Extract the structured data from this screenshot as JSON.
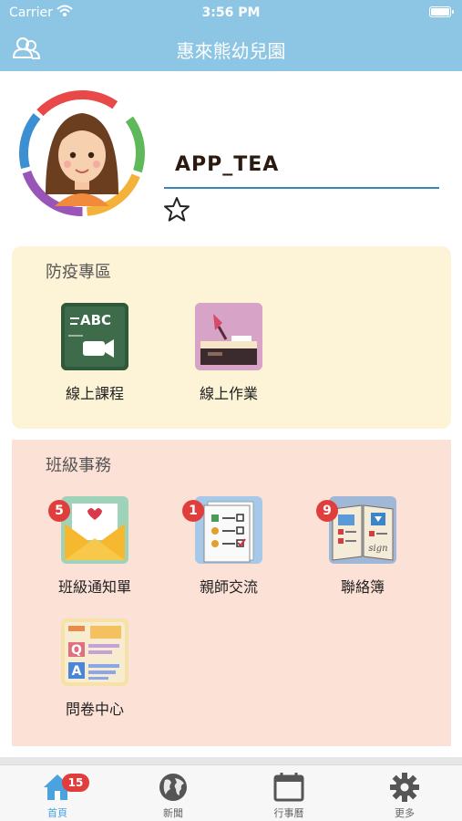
{
  "status_bar": {
    "carrier": "Carrier",
    "time": "3:56 PM"
  },
  "nav": {
    "title": "惠來熊幼兒園",
    "left_icon": "chat-users-icon"
  },
  "profile": {
    "username": "APP_TEA",
    "favorite_icon": "star-outline-icon"
  },
  "sections": {
    "epidemic": {
      "title": "防疫專區",
      "items": [
        {
          "label": "線上課程",
          "icon": "online-course-icon"
        },
        {
          "label": "線上作業",
          "icon": "online-homework-icon"
        }
      ]
    },
    "class_affairs": {
      "title": "班級事務",
      "items": [
        {
          "label": "班級通知單",
          "icon": "class-notice-icon",
          "badge": "5"
        },
        {
          "label": "親師交流",
          "icon": "parent-teacher-icon",
          "badge": "1"
        },
        {
          "label": "聯絡簿",
          "icon": "contact-book-icon",
          "badge": "9"
        },
        {
          "label": "問卷中心",
          "icon": "survey-center-icon"
        }
      ]
    }
  },
  "tab_bar": {
    "tabs": [
      {
        "label": "首頁",
        "icon": "home-icon",
        "active": true,
        "badge": "15"
      },
      {
        "label": "新聞",
        "icon": "globe-icon",
        "active": false
      },
      {
        "label": "行事曆",
        "icon": "calendar-icon",
        "active": false
      },
      {
        "label": "更多",
        "icon": "gear-icon",
        "active": false
      }
    ]
  },
  "colors": {
    "nav_bar": "#8cc6e4",
    "epidemic_bg": "#fdf3d6",
    "class_bg": "#fce1d6",
    "badge": "#e03d3d",
    "active_tab": "#4aa3df"
  }
}
